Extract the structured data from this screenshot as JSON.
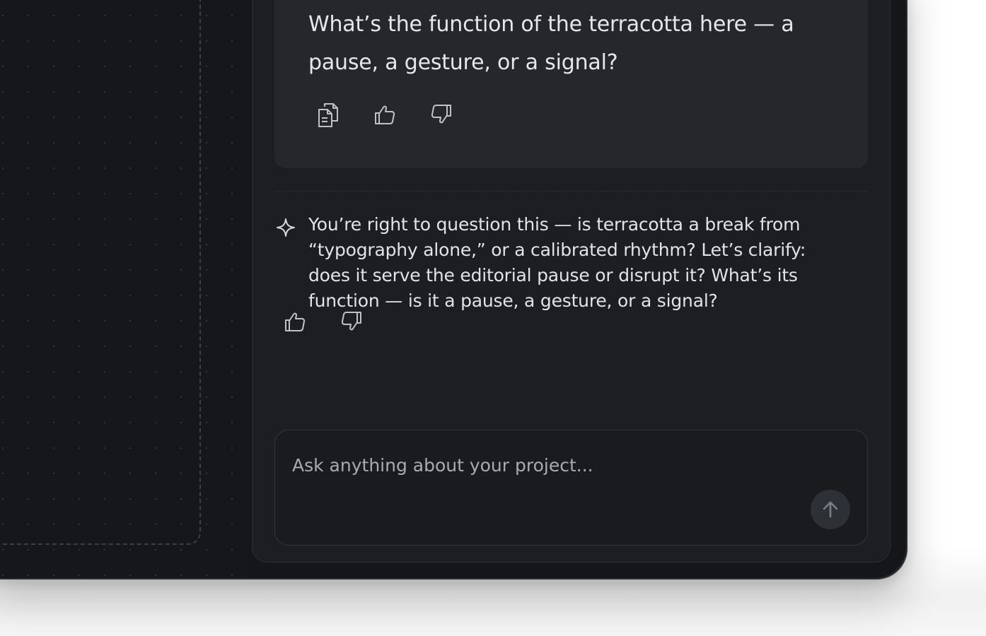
{
  "chat": {
    "user_message": "What’s the function of the terracotta here — a pause, a gesture, or a signal?",
    "assistant_message": "You’re right to question this — is terracotta a break from “typography alone,” or a calibrated rhythm? Let’s clarify: does it serve the editorial pause or disrupt it? What’s its function — is it a pause, a gesture, or a signal?",
    "user_actions": [
      "copy-icon",
      "thumbs-up-icon",
      "thumbs-down-icon"
    ],
    "assistant_actions": [
      "thumbs-up-icon",
      "thumbs-down-icon"
    ],
    "assistant_badge_icon": "sparkle-icon"
  },
  "composer": {
    "placeholder": "Ask anything about your project...",
    "value": "",
    "send_icon": "arrow-up-icon"
  },
  "colors": {
    "canvas_bg": "#15171b",
    "panel_bg": "#1c1e22",
    "user_bubble_bg": "#25272c",
    "text_primary": "#e6e7ea",
    "icon_stroke": "#bfc1c6"
  }
}
